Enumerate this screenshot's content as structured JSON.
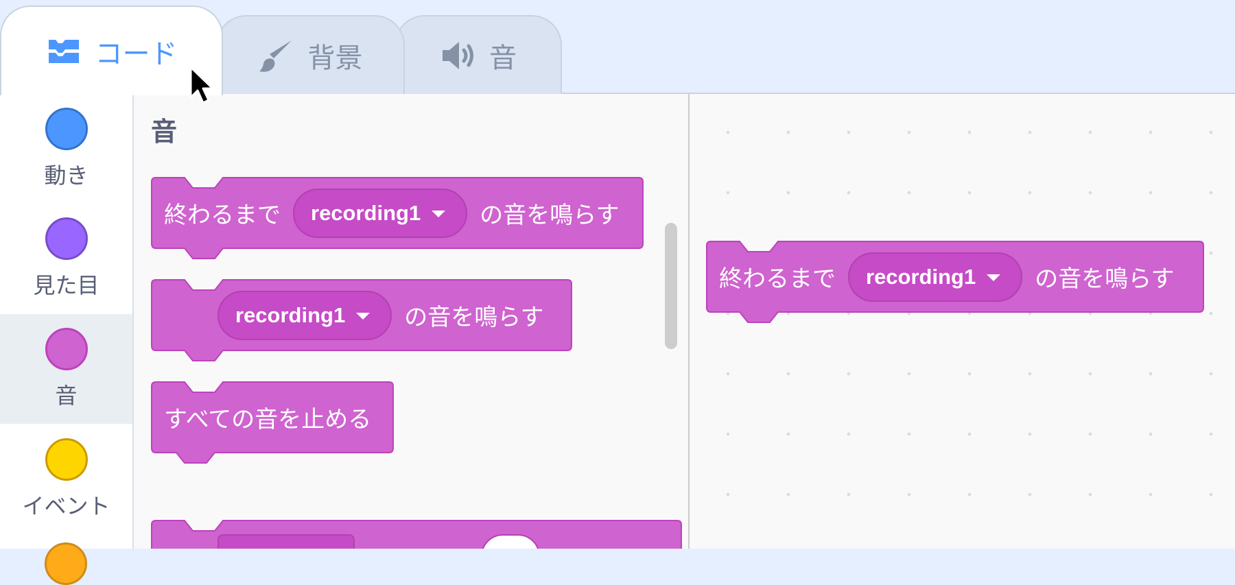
{
  "tabs": [
    {
      "label": "コード",
      "icon": "code-icon",
      "selected": true
    },
    {
      "label": "背景",
      "icon": "paintbrush-icon",
      "selected": false
    },
    {
      "label": "音",
      "icon": "speaker-icon",
      "selected": false
    }
  ],
  "categories": [
    {
      "label": "動き",
      "color": "#4c97ff",
      "border": "#3373cc",
      "selected": false
    },
    {
      "label": "見た目",
      "color": "#9966ff",
      "border": "#774dcb",
      "selected": false
    },
    {
      "label": "音",
      "color": "#cf63cf",
      "border": "#bd42bd",
      "selected": true
    },
    {
      "label": "イベント",
      "color": "#ffd500",
      "border": "#cc9900",
      "selected": false
    }
  ],
  "colors": {
    "sound_block": "#cf63cf",
    "sound_block_border": "#bd42bd",
    "sound_dropdown": "#c64bc6",
    "accent": "#4c97ff"
  },
  "flyout": {
    "heading": "音",
    "blocks": {
      "play_until_done": {
        "prefix": "終わるまで",
        "sound": "recording1",
        "suffix": "の音を鳴らす"
      },
      "start_sound": {
        "sound": "recording1",
        "suffix": "の音を鳴らす"
      },
      "stop_all": {
        "text": "すべての音を止める"
      }
    }
  },
  "workspace": {
    "block": {
      "prefix": "終わるまで",
      "sound": "recording1",
      "suffix": "の音を鳴らす"
    }
  }
}
